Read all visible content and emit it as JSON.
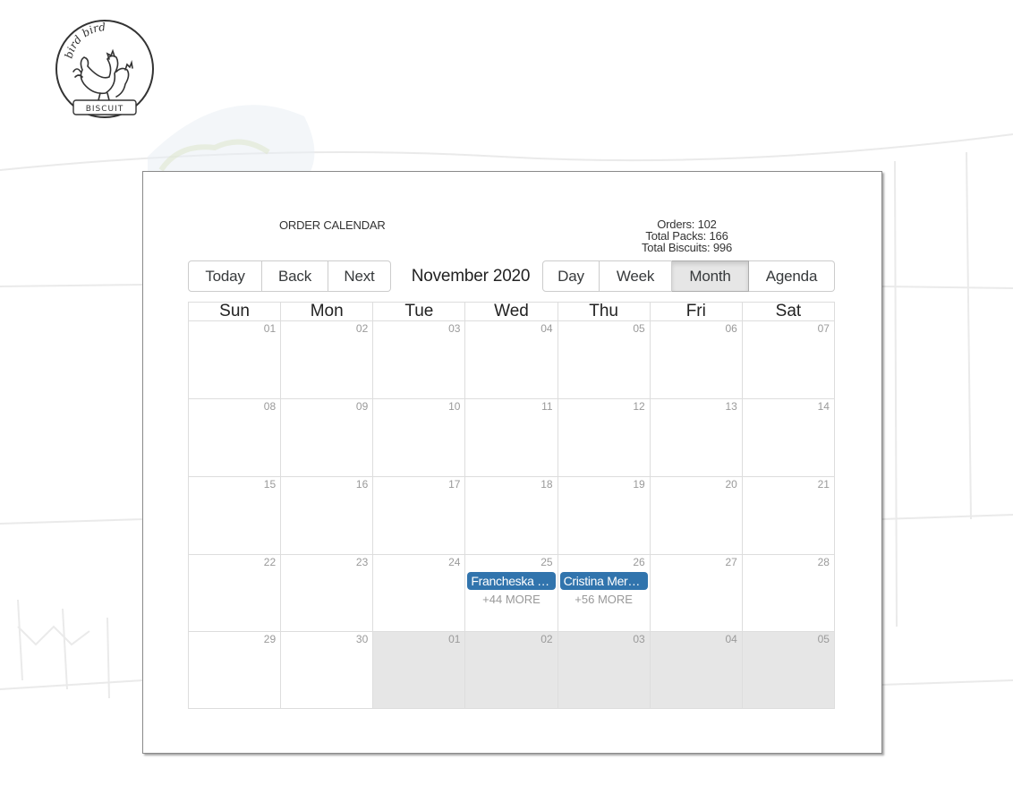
{
  "logo": {
    "top_text": "bird bird",
    "bottom_text": "BISCUIT"
  },
  "calendar": {
    "title": "ORDER CALENDAR",
    "stats": {
      "orders": "Orders: 102",
      "packs": "Total Packs: 166",
      "biscuits": "Total Biscuits: 996"
    },
    "nav_buttons": [
      "Today",
      "Back",
      "Next"
    ],
    "month_label": "November 2020",
    "view_buttons": [
      "Day",
      "Week",
      "Month",
      "Agenda"
    ],
    "active_view": "Month",
    "weekdays": [
      "Sun",
      "Mon",
      "Tue",
      "Wed",
      "Thu",
      "Fri",
      "Sat"
    ],
    "weeks": [
      [
        {
          "date": "01"
        },
        {
          "date": "02"
        },
        {
          "date": "03"
        },
        {
          "date": "04"
        },
        {
          "date": "05"
        },
        {
          "date": "06"
        },
        {
          "date": "07"
        }
      ],
      [
        {
          "date": "08"
        },
        {
          "date": "09"
        },
        {
          "date": "10"
        },
        {
          "date": "11"
        },
        {
          "date": "12"
        },
        {
          "date": "13"
        },
        {
          "date": "14"
        }
      ],
      [
        {
          "date": "15"
        },
        {
          "date": "16"
        },
        {
          "date": "17"
        },
        {
          "date": "18"
        },
        {
          "date": "19"
        },
        {
          "date": "20"
        },
        {
          "date": "21"
        }
      ],
      [
        {
          "date": "22"
        },
        {
          "date": "23"
        },
        {
          "date": "24"
        },
        {
          "date": "25",
          "event": "Francheska …",
          "more": "+44 MORE"
        },
        {
          "date": "26",
          "event": "Cristina Mer…",
          "more": "+56 MORE"
        },
        {
          "date": "27"
        },
        {
          "date": "28"
        }
      ],
      [
        {
          "date": "29"
        },
        {
          "date": "30"
        },
        {
          "date": "01",
          "off": true
        },
        {
          "date": "02",
          "off": true
        },
        {
          "date": "03",
          "off": true
        },
        {
          "date": "04",
          "off": true
        },
        {
          "date": "05",
          "off": true
        }
      ]
    ]
  },
  "colors": {
    "event_bg": "#3174ad",
    "off_range_bg": "#e6e6e6",
    "active_btn_bg": "#e6e6e6"
  }
}
